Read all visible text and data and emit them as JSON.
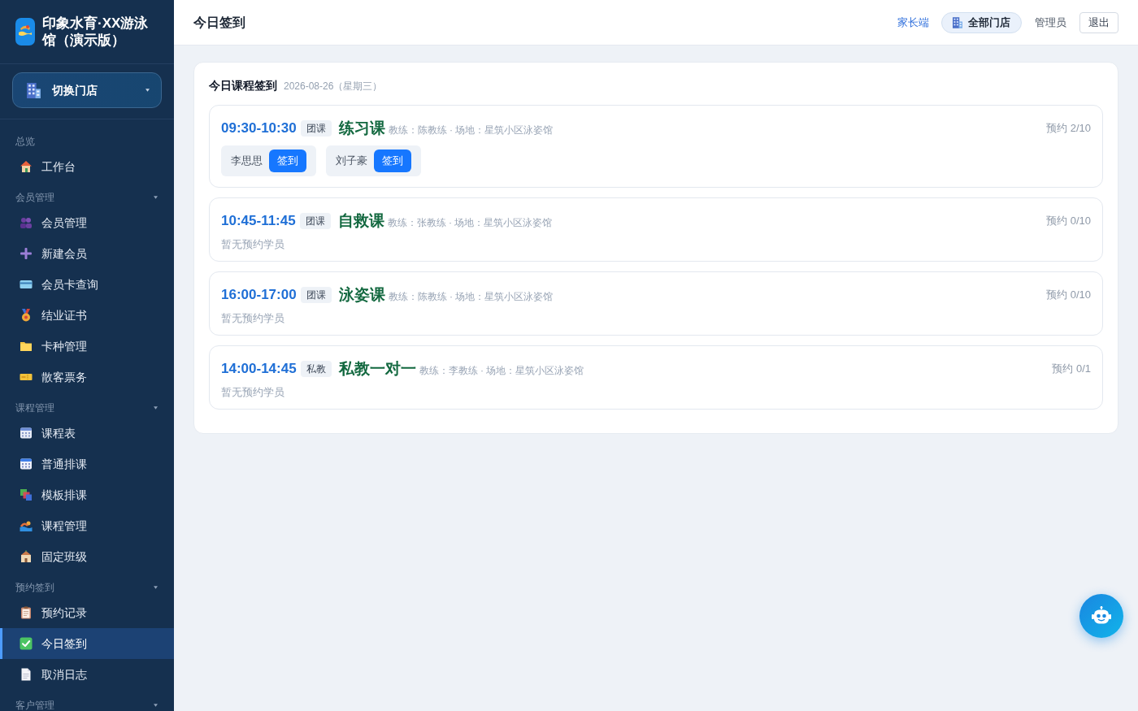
{
  "sidebar": {
    "brand": "印象水育·XX游泳馆（演示版）",
    "store_switch": {
      "label": "切换门店"
    },
    "groups": [
      {
        "title": "总览",
        "kind": "plain",
        "items": [
          {
            "label": "工作台",
            "selected": false
          }
        ]
      },
      {
        "title": "会员管理",
        "kind": "collapsible",
        "expanded": true,
        "items": [
          {
            "label": "会员管理",
            "selected": false
          },
          {
            "label": "新建会员",
            "selected": false
          },
          {
            "label": "会员卡查询",
            "selected": false
          },
          {
            "label": "结业证书",
            "selected": false
          },
          {
            "label": "卡种管理",
            "selected": false
          },
          {
            "label": "散客票务",
            "selected": false
          }
        ]
      },
      {
        "title": "课程管理",
        "kind": "collapsible",
        "expanded": true,
        "items": [
          {
            "label": "课程表",
            "selected": false
          },
          {
            "label": "普通排课",
            "selected": false
          },
          {
            "label": "模板排课",
            "selected": false
          },
          {
            "label": "课程管理",
            "selected": false
          },
          {
            "label": "固定班级",
            "selected": false
          }
        ]
      },
      {
        "title": "预约签到",
        "kind": "collapsible",
        "expanded": true,
        "items": [
          {
            "label": "预约记录",
            "selected": false
          },
          {
            "label": "今日签到",
            "selected": true
          },
          {
            "label": "取消日志",
            "selected": false
          }
        ]
      },
      {
        "title": "客户管理",
        "kind": "collapsible",
        "expanded": true
      }
    ]
  },
  "header": {
    "title": "今日签到",
    "parent_link": "家长端",
    "store_pill": "全部门店",
    "user": "管理员",
    "logout": "退出"
  },
  "panel": {
    "title": "今日课程签到",
    "date": "2026-08-26（星期三）",
    "courses": [
      {
        "time": "09:30-10:30",
        "type": "团课",
        "name": "练习课",
        "meta": "教练：陈教练 · 场地：星筑小区泳姿馆",
        "booking": "预约 2/10",
        "students": [
          {
            "name": "李思思",
            "action": "签到"
          },
          {
            "name": "刘子豪",
            "action": "签到"
          }
        ]
      },
      {
        "time": "10:45-11:45",
        "type": "团课",
        "name": "自救课",
        "meta": "教练：张教练 · 场地：星筑小区泳姿馆",
        "booking": "预约 0/10",
        "empty": "暂无预约学员"
      },
      {
        "time": "16:00-17:00",
        "type": "团课",
        "name": "泳姿课",
        "meta": "教练：陈教练 · 场地：星筑小区泳姿馆",
        "booking": "预约 0/10",
        "empty": "暂无预约学员"
      },
      {
        "time": "14:00-14:45",
        "type": "私教",
        "name": "私教一对一",
        "meta": "教练：李教练 · 场地：星筑小区泳姿馆",
        "booking": "预约 0/1",
        "empty": "暂无预约学员"
      }
    ]
  }
}
